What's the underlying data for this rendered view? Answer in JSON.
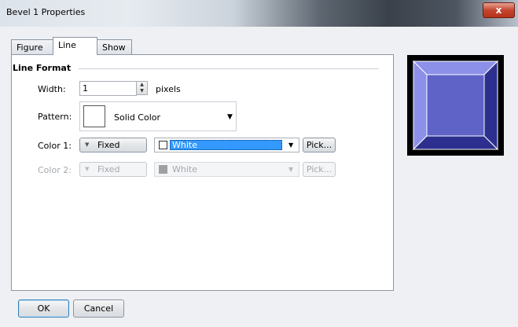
{
  "window": {
    "title": "Bevel 1 Properties",
    "close_glyph": "x"
  },
  "tabs": [
    {
      "label": "Figure"
    },
    {
      "label": "Line"
    },
    {
      "label": "Show"
    }
  ],
  "line_format": {
    "group_title": "Line Format",
    "width": {
      "label": "Width:",
      "value": "1",
      "unit": "pixels"
    },
    "pattern": {
      "label": "Pattern:",
      "value": "Solid Color"
    },
    "color1": {
      "label": "Color 1:",
      "mode": "Fixed",
      "color": "White",
      "pick_label": "Pick..."
    },
    "color2": {
      "label": "Color 2:",
      "mode": "Fixed",
      "color": "White",
      "pick_label": "Pick..."
    }
  },
  "buttons": {
    "ok": "OK",
    "cancel": "Cancel"
  },
  "colors": {
    "preview_face": "#5f62c7",
    "preview_light": "#8d90e8",
    "preview_dark": "#2c2f8e",
    "selection": "#3399ff",
    "disabled_swatch": "#a0a0a0"
  }
}
